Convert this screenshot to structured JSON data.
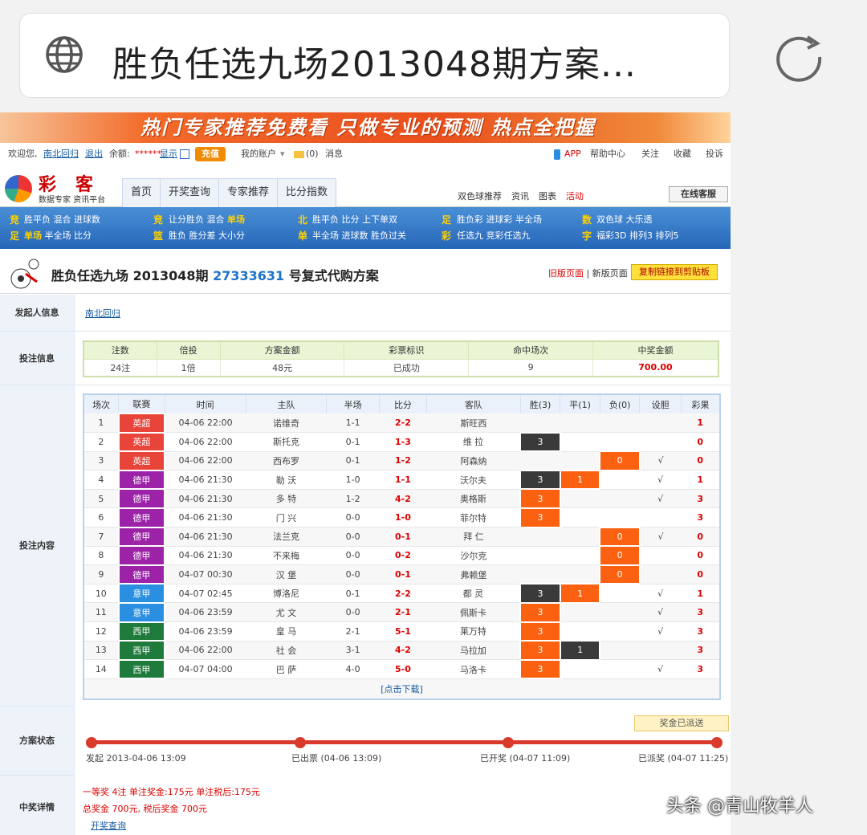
{
  "address_bar": {
    "title": "胜负任选九场2013048期方案...",
    "globe_icon": "globe-icon",
    "reload_icon": "reload-icon"
  },
  "banner": {
    "text": "热门专家推荐免费看 只做专业的预测 热点全把握"
  },
  "topbar": {
    "welcome": "欢迎您,",
    "user": "南北回归",
    "logout": "退出",
    "balance_label": "余额:",
    "balance": "******",
    "show": "显示",
    "recharge": "充值",
    "account": "我的账户",
    "msg_count": "(0)",
    "msg": "消息",
    "app": "APP",
    "help": "帮助中心",
    "follow": "关注",
    "fav": "收藏",
    "complaint": "投诉"
  },
  "logo": {
    "big": "彩客",
    "sub": "数据专家 资讯平台"
  },
  "nav": {
    "tabs": [
      "首页",
      "开奖查询",
      "专家推荐",
      "比分指数"
    ],
    "right": [
      "双色球推荐",
      "资讯",
      "图表",
      "活动"
    ],
    "service": "在线客服"
  },
  "lotto": {
    "g1": {
      "icon1": "竞",
      "icon2": "足",
      "line1": "胜平负  混合  进球数",
      "line2a": "单场",
      "line2b": " 半全场  比分"
    },
    "g2": {
      "icon1": "竞",
      "icon2": "篮",
      "line1a": "让分胜负  混合  ",
      "line1b": "单场",
      "line2": "胜负  胜分差  大小分"
    },
    "g3": {
      "icon1": "北",
      "icon2": "单",
      "line1": "胜平负  比分  上下单双",
      "line2": "半全场  进球数  胜负过关"
    },
    "g4": {
      "icon1": "足",
      "icon2": "彩",
      "line1": "胜负彩  进球彩  半全场",
      "line2": "任选九  竞彩任选九"
    },
    "g5": {
      "icon1": "数",
      "icon2": "字",
      "line1": "双色球  大乐透",
      "line2": "福彩3D  排列3  排列5"
    }
  },
  "scheme": {
    "title_a": "胜负任选九场 2013048期 ",
    "id": "27333631",
    "title_b": " 号复式代购方案",
    "old": "旧版页面",
    "sep": " | ",
    "new": "新版页面",
    "copy": "复制链接到剪贴板"
  },
  "labels": {
    "initiator": "发起人信息",
    "bet_info": "投注信息",
    "bet_content": "投注内容",
    "status": "方案状态",
    "win_detail": "中奖详情"
  },
  "initiator": "南北回归",
  "bet_info": {
    "headers": [
      "注数",
      "倍投",
      "方案金额",
      "彩票标识",
      "命中场次",
      "中奖金额"
    ],
    "values": [
      "24注",
      "1倍",
      "48元",
      "已成功",
      "9",
      "700.00"
    ]
  },
  "match_headers": [
    "场次",
    "联赛",
    "时间",
    "主队",
    "半场",
    "比分",
    "客队",
    "胜(3)",
    "平(1)",
    "负(0)",
    "设胆",
    "彩果"
  ],
  "matches": [
    {
      "no": "1",
      "league": "英超",
      "time": "04-06 22:00",
      "home": "诺维奇",
      "half": "1-1",
      "score": "2-2",
      "away": "斯旺西",
      "w": "",
      "d": "",
      "l": "",
      "dan": "",
      "res": "1"
    },
    {
      "no": "2",
      "league": "英超",
      "time": "04-06 22:00",
      "home": "斯托克",
      "half": "0-1",
      "score": "1-3",
      "away": "维 拉",
      "w": "3",
      "d": "",
      "l": "",
      "dan": "",
      "res": "0"
    },
    {
      "no": "3",
      "league": "英超",
      "time": "04-06 22:00",
      "home": "西布罗",
      "half": "0-1",
      "score": "1-2",
      "away": "阿森纳",
      "w": "",
      "d": "",
      "l": "0",
      "dan": "√",
      "res": "0"
    },
    {
      "no": "4",
      "league": "德甲",
      "time": "04-06 21:30",
      "home": "勒 沃",
      "half": "1-0",
      "score": "1-1",
      "away": "沃尔夫",
      "w": "3",
      "d": "1",
      "l": "",
      "dan": "√",
      "res": "1"
    },
    {
      "no": "5",
      "league": "德甲",
      "time": "04-06 21:30",
      "home": "多 特",
      "half": "1-2",
      "score": "4-2",
      "away": "奥格斯",
      "w": "3",
      "d": "",
      "l": "",
      "dan": "√",
      "res": "3"
    },
    {
      "no": "6",
      "league": "德甲",
      "time": "04-06 21:30",
      "home": "门 兴",
      "half": "0-0",
      "score": "1-0",
      "away": "菲尔特",
      "w": "3",
      "d": "",
      "l": "",
      "dan": "",
      "res": "3"
    },
    {
      "no": "7",
      "league": "德甲",
      "time": "04-06 21:30",
      "home": "法兰克",
      "half": "0-0",
      "score": "0-1",
      "away": "拜 仁",
      "w": "",
      "d": "",
      "l": "0",
      "dan": "√",
      "res": "0"
    },
    {
      "no": "8",
      "league": "德甲",
      "time": "04-06 21:30",
      "home": "不来梅",
      "half": "0-0",
      "score": "0-2",
      "away": "沙尔克",
      "w": "",
      "d": "",
      "l": "0",
      "dan": "",
      "res": "0"
    },
    {
      "no": "9",
      "league": "德甲",
      "time": "04-07 00:30",
      "home": "汉 堡",
      "half": "0-0",
      "score": "0-1",
      "away": "弗赖堡",
      "w": "",
      "d": "",
      "l": "0",
      "dan": "",
      "res": "0"
    },
    {
      "no": "10",
      "league": "意甲",
      "time": "04-07 02:45",
      "home": "博洛尼",
      "half": "0-1",
      "score": "2-2",
      "away": "都 灵",
      "w": "3",
      "d": "1",
      "l": "",
      "dan": "√",
      "res": "1"
    },
    {
      "no": "11",
      "league": "意甲",
      "time": "04-06 23:59",
      "home": "尤 文",
      "half": "0-0",
      "score": "2-1",
      "away": "佩斯卡",
      "w": "3",
      "d": "",
      "l": "",
      "dan": "√",
      "res": "3"
    },
    {
      "no": "12",
      "league": "西甲",
      "time": "04-06 23:59",
      "home": "皇 马",
      "half": "2-1",
      "score": "5-1",
      "away": "莱万特",
      "w": "3",
      "d": "",
      "l": "",
      "dan": "√",
      "res": "3"
    },
    {
      "no": "13",
      "league": "西甲",
      "time": "04-06 22:00",
      "home": "社 会",
      "half": "3-1",
      "score": "4-2",
      "away": "马拉加",
      "w": "3",
      "d": "1",
      "l": "",
      "dan": "",
      "res": "3"
    },
    {
      "no": "14",
      "league": "西甲",
      "time": "04-07 04:00",
      "home": "巴 萨",
      "half": "4-0",
      "score": "5-0",
      "away": "马洛卡",
      "w": "3",
      "d": "",
      "l": "",
      "dan": "√",
      "res": "3"
    }
  ],
  "dark_cells": {
    "w": [
      "2",
      "4",
      "10"
    ],
    "d": [
      "13"
    ]
  },
  "league_colors": {
    "英超": "#e8443a",
    "德甲": "#9c22a8",
    "意甲": "#2a8fe0",
    "西甲": "#1f7b3c"
  },
  "download": "[点击下载]",
  "status": {
    "tip": "奖金已派送",
    "steps": [
      "发起 2013-04-06 13:09",
      "已出票 (04-06 13:09)",
      "已开奖 (04-07 11:09)",
      "已派奖 (04-07 11:25)"
    ]
  },
  "win": {
    "line1": "一等奖 4注 单注奖金:175元 单注税后:175元",
    "line2": "总奖金 700元, 税后奖金 700元",
    "link": "开奖查询"
  },
  "watermark": "头条 @青山牧羊人"
}
